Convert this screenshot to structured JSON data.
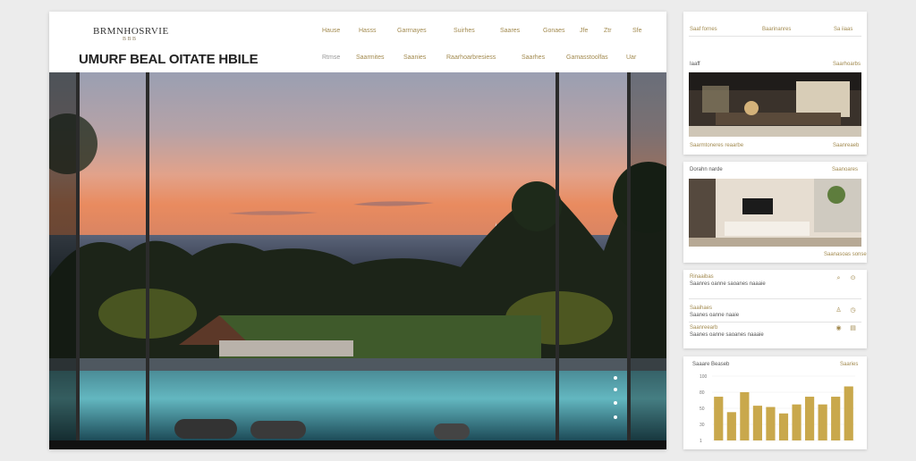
{
  "header": {
    "brand": "BRMNHOSRVIE",
    "brand_sub": "B B B",
    "site_title": "UMURF BEAL OITATE HBILE",
    "nav_top": [
      "Hause",
      "Hasss",
      "Garrnayes",
      "Suirhes",
      "Saares",
      "Gonaes",
      "Jfe",
      "Ztr",
      "Sfe"
    ],
    "nav_bottom": [
      "Rtmse",
      "Saarmites",
      "Saanies",
      "Raarhoarbresiess",
      "Saarhes",
      "Gamasstoolfas",
      "Uar"
    ]
  },
  "sidebar": {
    "card1": {
      "left": "Saaf fornes",
      "mid": "Baarinanres",
      "right": "Sa iiaas"
    },
    "card2": {
      "label": "Iaaff",
      "right": "Saarhoarbs",
      "foot_left": "Saarmtoneres reaarbe",
      "foot_right": "Saanreaeb"
    },
    "card3": {
      "label": "Dorahn narde",
      "right": "Saanoares",
      "foot": "Saanasoas sonse"
    },
    "list": [
      {
        "title": "Rinaaibas",
        "text": "Saanres oanne saoanes naaaie"
      },
      {
        "title": "Saaihaes",
        "text": "Saanes oanne naaie"
      },
      {
        "title": "Saanreearb",
        "text": "Saanes oanne saoanes naaaie"
      }
    ],
    "chart_card": {
      "title": "Saaare Beaseb",
      "right": "Saaries"
    }
  },
  "icons": {
    "row1a": "search-icon",
    "row1b": "pin-icon",
    "row2a": "lamp-icon",
    "row2b": "clock-icon",
    "row3a": "eye-icon",
    "row3b": "doc-icon"
  },
  "chart_data": {
    "type": "bar",
    "ylabels": [
      "100",
      "80",
      "50",
      "30",
      "1"
    ],
    "values": [
      68,
      44,
      75,
      54,
      52,
      42,
      56,
      68,
      56,
      68,
      84
    ],
    "ylim": [
      0,
      100
    ]
  }
}
